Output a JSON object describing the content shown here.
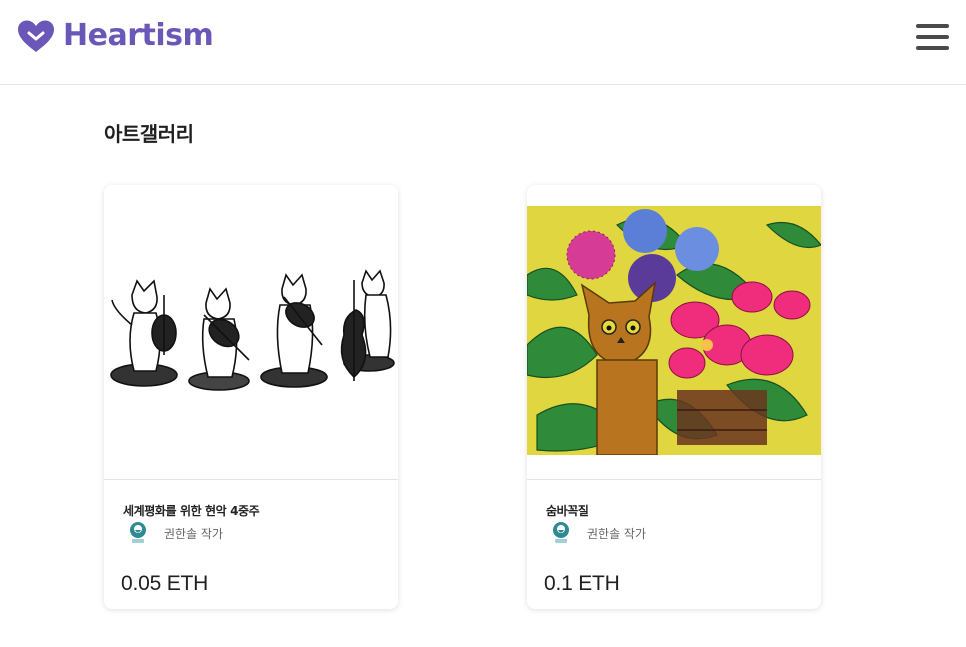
{
  "app": {
    "brand": "Heartism"
  },
  "page": {
    "title": "아트갤러리"
  },
  "artworks": [
    {
      "title": "세계평화를 위한 현악 4중주",
      "artist": "권한솔 작가",
      "price": "0.05 ETH"
    },
    {
      "title": "숨바꼭질",
      "artist": "권한솔 작가",
      "price": "0.1 ETH"
    }
  ],
  "colors": {
    "brand": "#6b57b8",
    "menu": "#4a4a4a"
  },
  "icons": {
    "logo": "heart-icon",
    "menu": "hamburger-menu-icon",
    "avatar": "artist-avatar-icon"
  }
}
